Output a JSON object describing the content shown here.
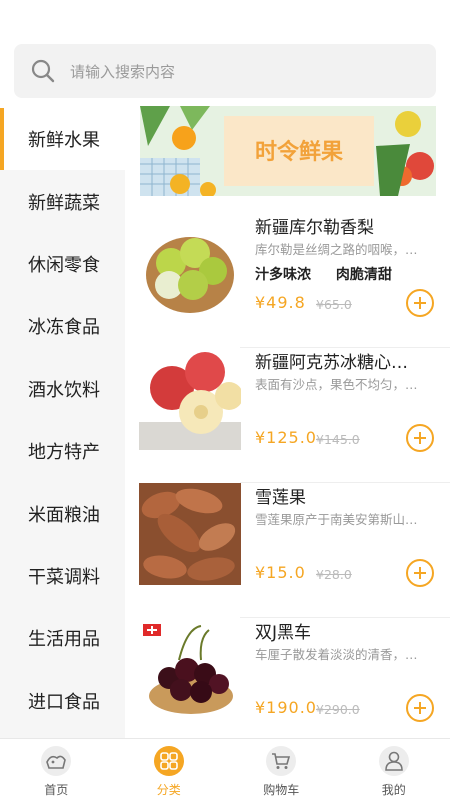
{
  "search": {
    "placeholder": "请输入搜索内容"
  },
  "sidebar": {
    "items": [
      {
        "label": "新鲜水果",
        "active": true
      },
      {
        "label": "新鲜蔬菜"
      },
      {
        "label": "休闲零食"
      },
      {
        "label": "冰冻食品"
      },
      {
        "label": "酒水饮料"
      },
      {
        "label": "地方特产"
      },
      {
        "label": "米面粮油"
      },
      {
        "label": "干菜调料"
      },
      {
        "label": "生活用品"
      },
      {
        "label": "进口食品"
      }
    ]
  },
  "banner": {
    "title": "时令鲜果"
  },
  "products": [
    {
      "name": "新疆库尔勒香梨",
      "desc": "库尔勒是丝绸之路的咽喉，…",
      "tags": [
        "汁多味浓",
        "肉脆清甜"
      ],
      "price": "¥49.8",
      "old_price": "¥65.0"
    },
    {
      "name": "新疆阿克苏冰糖心…",
      "desc": "表面有沙点，果色不均匀，…",
      "price": "¥125.0",
      "old_price": "¥145.0"
    },
    {
      "name": "雪莲果",
      "desc": "雪莲果原产于南美安第斯山…",
      "price": "¥15.0",
      "old_price": "¥28.0"
    },
    {
      "name": "双J黑车",
      "desc": "车厘子散发着淡淡的清香，…",
      "price": "¥190.0",
      "old_price": "¥290.0"
    }
  ],
  "tabbar": {
    "items": [
      {
        "label": "首页"
      },
      {
        "label": "分类",
        "active": true
      },
      {
        "label": "购物车"
      },
      {
        "label": "我的"
      }
    ]
  },
  "colors": {
    "accent": "#f5a623"
  }
}
